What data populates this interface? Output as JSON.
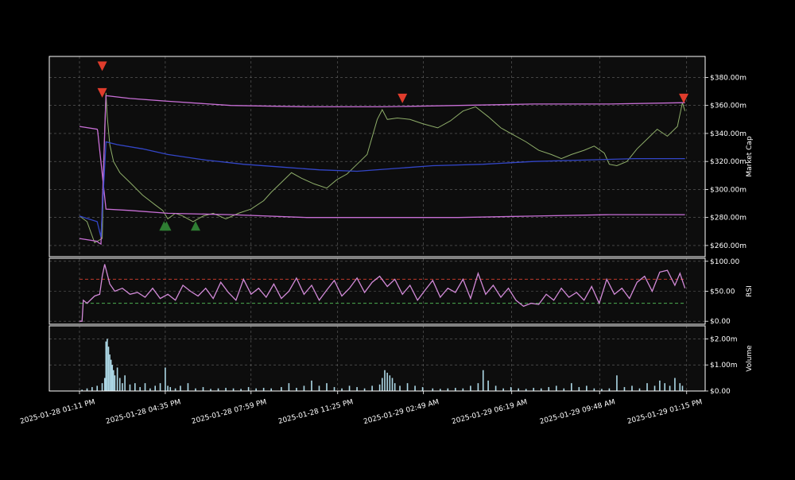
{
  "chart_data": [
    {
      "type": "line",
      "panel": "price",
      "ylabel": "Market Cap",
      "ylim": [
        252,
        395
      ],
      "yticks": [
        260,
        280,
        300,
        320,
        340,
        360,
        380
      ],
      "ytick_labels": [
        "$260.00m",
        "$280.00m",
        "$300.00m",
        "$320.00m",
        "$340.00m",
        "$360.00m",
        "$380.00m"
      ],
      "x_range_hours": [
        0,
        24.07
      ],
      "grid": true,
      "series": [
        {
          "name": "price",
          "color": "#8fae6a",
          "x": [
            0,
            0.3,
            0.6,
            0.9,
            1.0,
            1.05,
            1.1,
            1.2,
            1.35,
            1.6,
            2.0,
            2.5,
            3.0,
            3.3,
            3.5,
            3.8,
            4.1,
            4.5,
            4.9,
            5.3,
            5.8,
            6.3,
            6.8,
            7.3,
            7.6,
            8.0,
            8.4,
            8.8,
            9.3,
            9.8,
            10.2,
            10.6,
            11.0,
            11.4,
            11.8,
            12.0,
            12.2,
            12.6,
            13.1,
            13.6,
            14.2,
            14.7,
            15.2,
            15.7,
            16.2,
            16.7,
            17.2,
            17.7,
            18.2,
            18.7,
            19.1,
            19.5,
            20.0,
            20.4,
            20.8,
            21.0,
            21.3,
            21.7,
            22.1,
            22.5,
            22.9,
            23.3,
            23.7,
            23.9,
            24.0
          ],
          "y": [
            281,
            277,
            262,
            265,
            345,
            369,
            352,
            332,
            320,
            312,
            305,
            296,
            289,
            285,
            279,
            283,
            281,
            277,
            281,
            283,
            279,
            283,
            286,
            292,
            298,
            305,
            312,
            308,
            304,
            301,
            307,
            311,
            318,
            325,
            350,
            357,
            350,
            351,
            350,
            347,
            344,
            349,
            356,
            359,
            352,
            344,
            339,
            334,
            328,
            325,
            322,
            325,
            328,
            331,
            326,
            318,
            317,
            320,
            329,
            336,
            343,
            338,
            345,
            362,
            356
          ]
        },
        {
          "name": "upper-band",
          "color": "#c86fd6",
          "x": [
            0,
            0.7,
            0.75,
            0.85,
            1.05,
            2,
            3.5,
            6,
            9,
            12,
            15,
            18,
            21,
            24
          ],
          "y": [
            265,
            263,
            262,
            261,
            367,
            365,
            363,
            360,
            359,
            359,
            360,
            361,
            361,
            362
          ]
        },
        {
          "name": "lower-band",
          "color": "#c86fd6",
          "x": [
            0,
            0.7,
            0.72,
            1.05,
            2,
            3.5,
            6,
            9,
            12,
            15,
            18,
            21,
            24
          ],
          "y": [
            345,
            343,
            342,
            286,
            285,
            283,
            282,
            280,
            280,
            280,
            281,
            282,
            282
          ]
        },
        {
          "name": "middle-band",
          "color": "#3346c8",
          "x": [
            0,
            0.7,
            0.85,
            1.05,
            1.5,
            2.5,
            3.5,
            5,
            6.5,
            8,
            9.5,
            11,
            12.5,
            14,
            16,
            18,
            20,
            22,
            24
          ],
          "y": [
            281,
            277,
            266,
            334,
            332,
            329,
            325,
            321,
            318,
            316,
            314,
            313,
            315,
            317,
            318,
            320,
            321,
            322,
            322
          ]
        }
      ],
      "markers": [
        {
          "type": "sell",
          "symbol": "triangle-down",
          "color": "#e03c2c",
          "x": 0.9,
          "y": 388
        },
        {
          "type": "sell",
          "symbol": "triangle-down",
          "color": "#e03c2c",
          "x": 0.9,
          "y": 369
        },
        {
          "type": "sell",
          "symbol": "triangle-down",
          "color": "#e03c2c",
          "x": 12.8,
          "y": 365
        },
        {
          "type": "sell",
          "symbol": "triangle-down",
          "color": "#e03c2c",
          "x": 23.95,
          "y": 365
        },
        {
          "type": "buy",
          "symbol": "triangle-up",
          "color": "#2e7d32",
          "x": 3.35,
          "y": 274
        },
        {
          "type": "buy",
          "symbol": "triangle-up",
          "color": "#2e7d32",
          "x": 3.45,
          "y": 274
        },
        {
          "type": "buy",
          "symbol": "triangle-up",
          "color": "#2e7d32",
          "x": 4.6,
          "y": 274
        }
      ]
    },
    {
      "type": "line",
      "panel": "rsi",
      "ylabel": "RSI",
      "ylim": [
        -5,
        105
      ],
      "yticks": [
        0,
        50,
        100
      ],
      "ytick_labels": [
        "$0.00",
        "$50.00",
        "$100.00"
      ],
      "reference_lines": [
        {
          "value": 70,
          "color": "#c0392b",
          "style": "dashed"
        },
        {
          "value": 30,
          "color": "#4caf50",
          "style": "dashed"
        }
      ],
      "series": [
        {
          "name": "RSI",
          "color": "#d28ad8",
          "x": [
            0,
            0.1,
            0.15,
            0.3,
            0.6,
            0.8,
            0.9,
            1.0,
            1.2,
            1.4,
            1.7,
            2.0,
            2.3,
            2.6,
            2.9,
            3.2,
            3.5,
            3.8,
            4.1,
            4.4,
            4.7,
            5.0,
            5.3,
            5.6,
            5.9,
            6.2,
            6.5,
            6.8,
            7.1,
            7.4,
            7.7,
            8.0,
            8.3,
            8.6,
            8.9,
            9.2,
            9.5,
            9.8,
            10.1,
            10.4,
            10.7,
            11.0,
            11.3,
            11.6,
            11.9,
            12.2,
            12.5,
            12.8,
            13.1,
            13.4,
            13.7,
            14.0,
            14.3,
            14.6,
            14.9,
            15.2,
            15.5,
            15.8,
            16.1,
            16.4,
            16.7,
            17.0,
            17.3,
            17.6,
            17.9,
            18.2,
            18.5,
            18.8,
            19.1,
            19.4,
            19.7,
            20.0,
            20.3,
            20.6,
            20.9,
            21.2,
            21.5,
            21.8,
            22.1,
            22.4,
            22.7,
            23.0,
            23.3,
            23.6,
            23.8,
            24.0
          ],
          "y": [
            0,
            0,
            35,
            30,
            42,
            45,
            75,
            95,
            62,
            50,
            55,
            45,
            48,
            40,
            55,
            38,
            45,
            35,
            60,
            50,
            42,
            55,
            38,
            65,
            48,
            35,
            70,
            45,
            55,
            40,
            62,
            38,
            50,
            72,
            45,
            60,
            35,
            52,
            68,
            42,
            55,
            72,
            48,
            65,
            75,
            58,
            70,
            45,
            60,
            35,
            52,
            68,
            40,
            55,
            48,
            70,
            38,
            80,
            45,
            60,
            40,
            55,
            35,
            25,
            30,
            28,
            45,
            35,
            55,
            40,
            48,
            35,
            58,
            30,
            70,
            45,
            55,
            38,
            65,
            75,
            50,
            82,
            85,
            60,
            80,
            55
          ]
        }
      ]
    },
    {
      "type": "bar",
      "panel": "volume",
      "ylabel": "Volume",
      "ylim": [
        0,
        2.5
      ],
      "yticks": [
        0,
        1,
        2
      ],
      "ytick_labels": [
        "$0.00",
        "$1.00m",
        "$2.00m"
      ],
      "series": [
        {
          "name": "volume",
          "color": "#add8e6",
          "x": [
            0.1,
            0.3,
            0.5,
            0.7,
            0.9,
            1.0,
            1.05,
            1.1,
            1.15,
            1.2,
            1.25,
            1.3,
            1.35,
            1.4,
            1.5,
            1.6,
            1.7,
            1.8,
            2.0,
            2.2,
            2.4,
            2.6,
            2.8,
            3.0,
            3.2,
            3.4,
            3.5,
            3.6,
            3.8,
            4.0,
            4.3,
            4.6,
            4.9,
            5.2,
            5.5,
            5.8,
            6.1,
            6.4,
            6.7,
            7.0,
            7.3,
            7.6,
            8.0,
            8.3,
            8.6,
            8.9,
            9.2,
            9.5,
            9.8,
            10.1,
            10.4,
            10.7,
            11.0,
            11.3,
            11.6,
            11.9,
            12.0,
            12.1,
            12.2,
            12.3,
            12.4,
            12.5,
            12.7,
            13.0,
            13.3,
            13.6,
            14.0,
            14.3,
            14.6,
            14.9,
            15.2,
            15.5,
            15.8,
            16.0,
            16.2,
            16.5,
            16.8,
            17.1,
            17.4,
            17.7,
            18.0,
            18.3,
            18.6,
            18.9,
            19.2,
            19.5,
            19.8,
            20.1,
            20.4,
            20.7,
            21.0,
            21.3,
            21.6,
            21.9,
            22.2,
            22.5,
            22.8,
            23.0,
            23.2,
            23.4,
            23.6,
            23.8,
            23.9
          ],
          "y": [
            0.05,
            0.1,
            0.15,
            0.2,
            0.3,
            0.5,
            1.9,
            2.0,
            1.7,
            1.4,
            1.2,
            1.0,
            0.8,
            0.6,
            0.9,
            0.5,
            0.3,
            0.6,
            0.25,
            0.3,
            0.15,
            0.3,
            0.1,
            0.2,
            0.3,
            0.9,
            0.2,
            0.15,
            0.1,
            0.2,
            0.3,
            0.1,
            0.15,
            0.08,
            0.1,
            0.12,
            0.1,
            0.08,
            0.15,
            0.1,
            0.12,
            0.1,
            0.15,
            0.3,
            0.12,
            0.2,
            0.4,
            0.2,
            0.3,
            0.15,
            0.1,
            0.2,
            0.15,
            0.1,
            0.2,
            0.25,
            0.5,
            0.8,
            0.7,
            0.6,
            0.5,
            0.3,
            0.2,
            0.3,
            0.2,
            0.15,
            0.1,
            0.08,
            0.1,
            0.12,
            0.1,
            0.2,
            0.3,
            0.8,
            0.4,
            0.2,
            0.1,
            0.15,
            0.1,
            0.08,
            0.12,
            0.1,
            0.15,
            0.2,
            0.1,
            0.3,
            0.15,
            0.2,
            0.1,
            0.08,
            0.1,
            0.6,
            0.15,
            0.2,
            0.1,
            0.3,
            0.2,
            0.4,
            0.3,
            0.2,
            0.5,
            0.3,
            0.2
          ]
        }
      ]
    }
  ],
  "x_axis": {
    "tick_positions_hours": [
      0,
      3.4,
      6.8,
      10.233,
      13.633,
      17.133,
      20.617,
      24.067
    ],
    "tick_labels": [
      "2025-01-28 01:11 PM",
      "2025-01-28 04:35 PM",
      "2025-01-28 07:59 PM",
      "2025-01-28 11:25 PM",
      "2025-01-29 02:49 AM",
      "2025-01-29 06:19 AM",
      "2025-01-29 09:48 AM",
      "2025-01-29 01:15 PM"
    ]
  },
  "colors": {
    "background": "#000000",
    "panel_bg": "#0d0d0d",
    "frame": "#ffffff",
    "grid": "#666666"
  }
}
